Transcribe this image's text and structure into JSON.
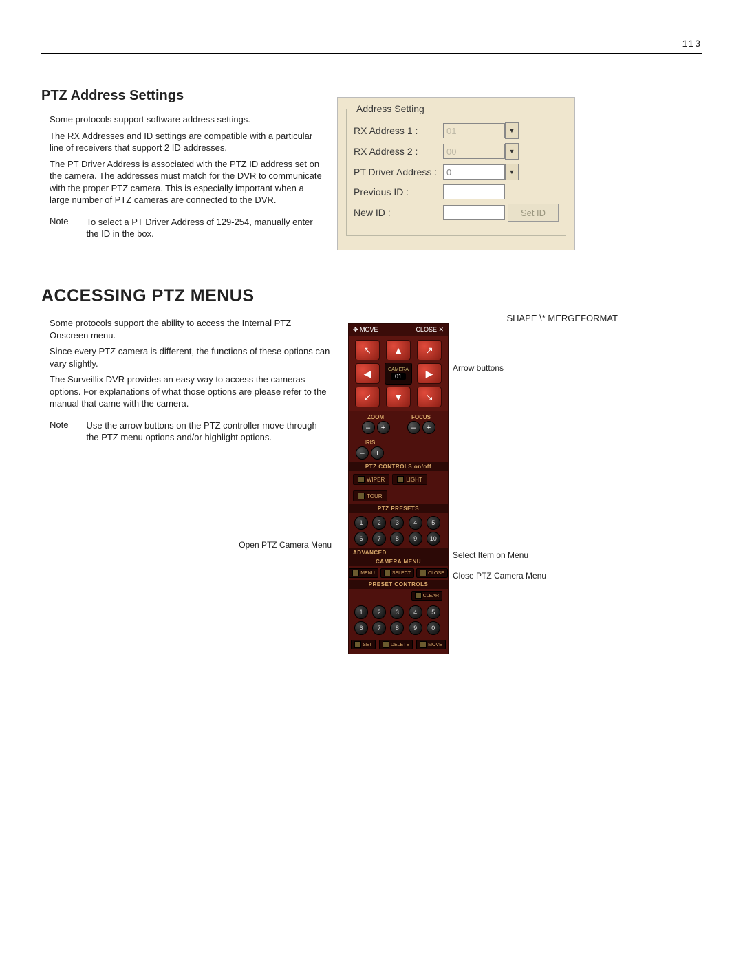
{
  "page_number": "113",
  "section1": {
    "title": "PTZ Address Settings",
    "p1": "Some protocols support software address settings.",
    "p2": "The RX Addresses and ID settings are compatible with a particular line of receivers that support 2 ID addresses.",
    "p3": "The PT Driver Address is associated with the PTZ ID address set on the camera. The addresses must match for the DVR to communicate with the proper PTZ camera. This is especially important when a large number of PTZ cameras are connected to the DVR.",
    "note_label": "Note",
    "note_body": "To select a PT Driver Address of 129-254, manually enter the ID in the box."
  },
  "address_panel": {
    "legend": "Address Setting",
    "rx1_label": "RX Address 1 :",
    "rx1_value": "01",
    "rx2_label": "RX Address 2 :",
    "rx2_value": "00",
    "ptd_label": "PT Driver Address  :",
    "ptd_value": "0",
    "prev_label": "Previous ID :",
    "new_label": "New ID :",
    "setid_label": "Set ID"
  },
  "section2": {
    "title": "ACCESSING PTZ MENUS",
    "p1": "Some protocols support the ability to access the Internal PTZ Onscreen menu.",
    "p2": "Since every PTZ camera is different, the functions of these options can vary slightly.",
    "p3": "The Surveillix DVR provides an easy way to access the cameras options. For explanations of what those options are please refer to the manual that came with the camera.",
    "note_label": "Note",
    "note_body": "Use the arrow buttons on the PTZ controller move through the PTZ menu options and/or highlight options."
  },
  "shape_text": "SHAPE  \\* MERGEFORMAT",
  "ptz": {
    "move": "✥ MOVE",
    "close": "CLOSE ✕",
    "camera_label": "CAMERA",
    "camera_num": "01",
    "zoom": "ZOOM",
    "focus": "FOCUS",
    "iris": "IRIS",
    "controls_title": "PTZ CONTROLS  on/off",
    "wiper": "WIPER",
    "light": "LIGHT",
    "tour": "TOUR",
    "presets_title": "PTZ PRESETS",
    "nums1": [
      "1",
      "2",
      "3",
      "4",
      "5"
    ],
    "nums2": [
      "6",
      "7",
      "8",
      "9",
      "10"
    ],
    "advanced": "ADVANCED",
    "camera_menu_title": "CAMERA MENU",
    "menu_btn": "MENU",
    "select_btn": "SELECT",
    "close_btn": "CLOSE",
    "preset_controls_title": "PRESET CONTROLS",
    "clear": "CLEAR",
    "nums3": [
      "1",
      "2",
      "3",
      "4",
      "5"
    ],
    "nums4": [
      "6",
      "7",
      "8",
      "9",
      "0"
    ],
    "set": "SET",
    "delete": "DELETE",
    "move_b": "MOVE"
  },
  "callouts": {
    "arrow_buttons": "Arrow buttons",
    "open_menu": "Open PTZ Camera Menu",
    "select_item": "Select Item on Menu",
    "close_menu": "Close PTZ Camera Menu"
  }
}
